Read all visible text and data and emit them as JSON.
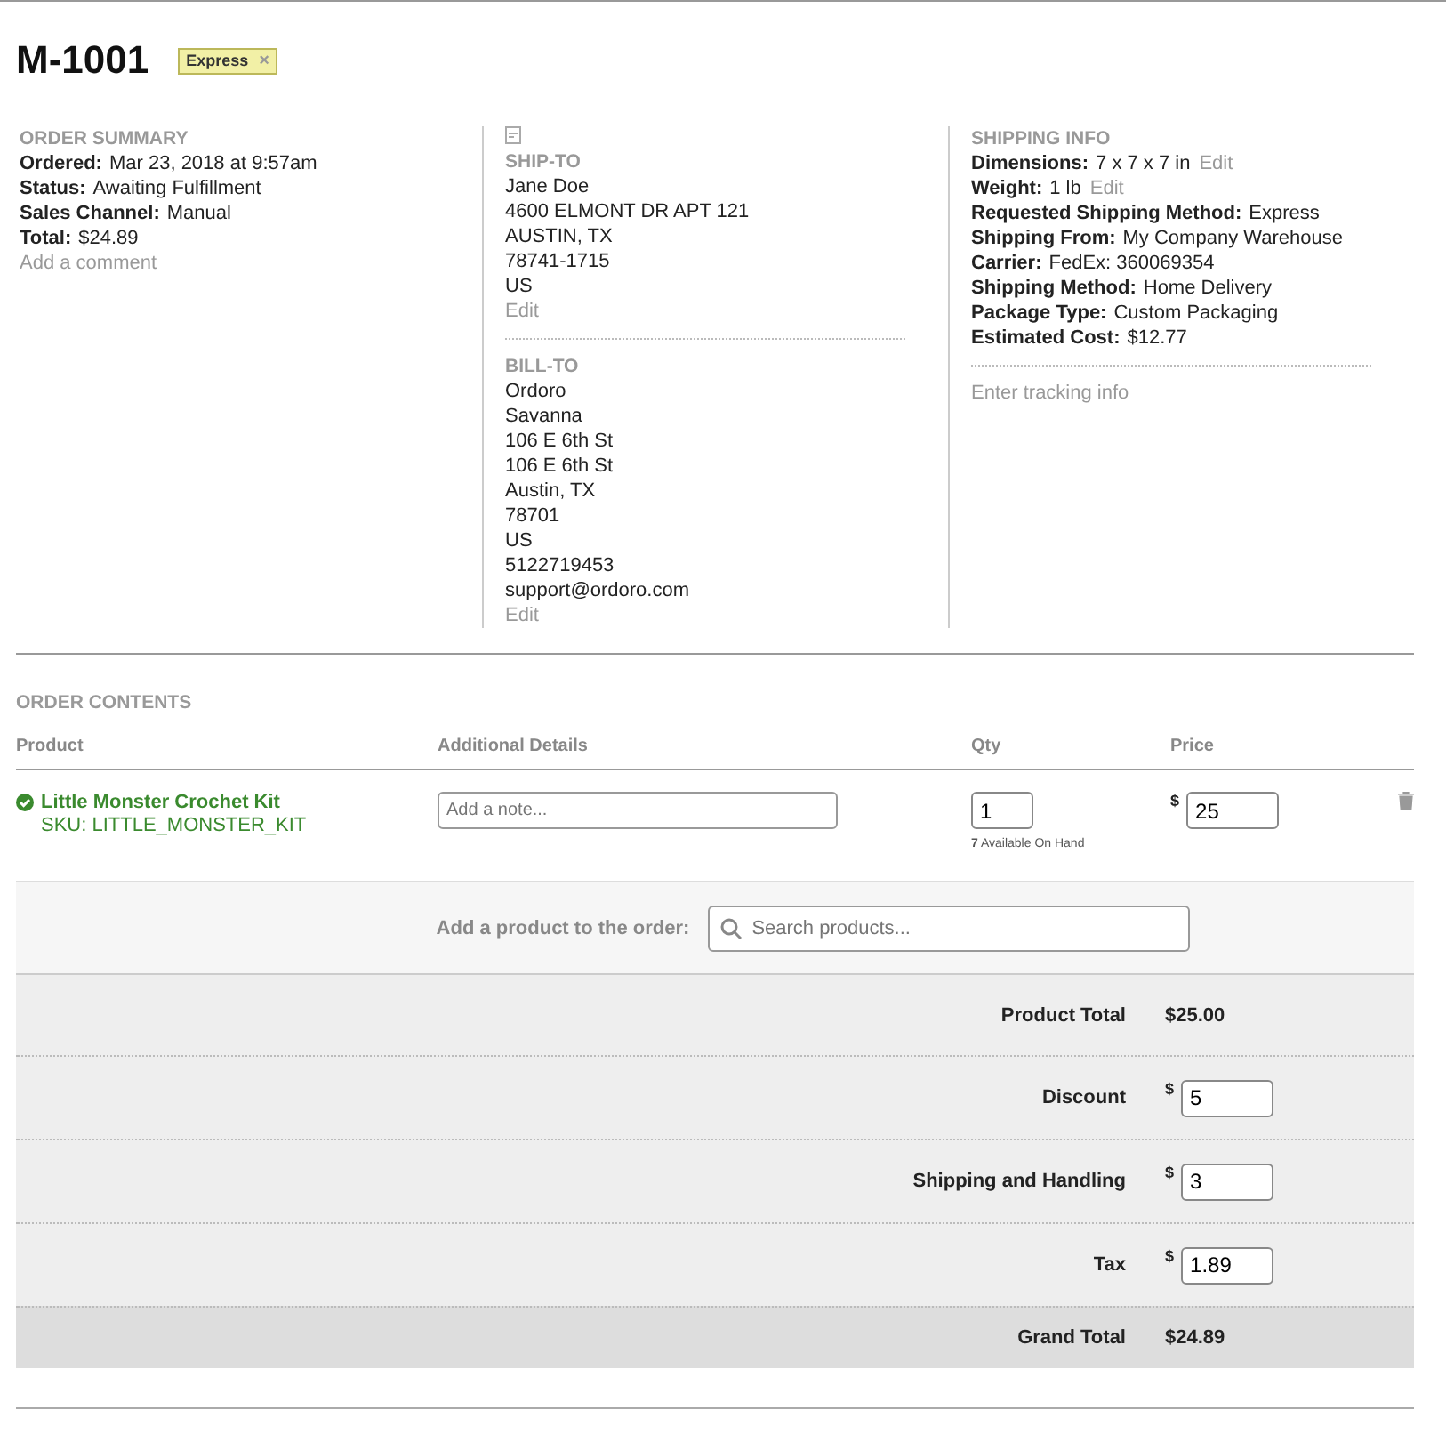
{
  "order": {
    "number": "M-1001",
    "tags": [
      {
        "label": "Express",
        "remove": "×",
        "color": "#f2f0a6"
      }
    ]
  },
  "summary": {
    "heading": "ORDER SUMMARY",
    "fields": [
      {
        "label": "Ordered:",
        "value": "Mar 23, 2018 at 9:57am"
      },
      {
        "label": "Status:",
        "value": "Awaiting Fulfillment"
      },
      {
        "label": "Sales Channel:",
        "value": "Manual"
      },
      {
        "label": "Total:",
        "value": "$24.89"
      }
    ],
    "link": "Add a comment"
  },
  "addresses": [
    {
      "heading": "SHIP-TO",
      "lines": [
        "Jane Doe",
        "4600 ELMONT DR APT 121",
        "AUSTIN, TX",
        "78741-1715",
        "US"
      ],
      "link": "Edit"
    },
    {
      "heading": "BILL-TO",
      "lines": [
        "Ordoro",
        "Savanna",
        "106 E 6th St",
        "106 E 6th St",
        "Austin, TX",
        "78701",
        "US",
        "5122719453",
        "support@ordoro.com"
      ],
      "link": "Edit"
    }
  ],
  "shipping": {
    "heading": "SHIPPING INFO",
    "fields": [
      {
        "label": "Dimensions:",
        "value": "7 x 7 x 7 in",
        "link": "Edit"
      },
      {
        "label": "Weight:",
        "value": "1 lb",
        "link": "Edit"
      },
      {
        "label": "Requested Shipping Method:",
        "value": "Express"
      },
      {
        "label": "Shipping From:",
        "value": "My Company Warehouse"
      },
      {
        "label": "Carrier:",
        "value": "FedEx: 360069354"
      },
      {
        "label": "Shipping Method:",
        "value": "Home Delivery"
      },
      {
        "label": "Package Type:",
        "value": "Custom Packaging"
      },
      {
        "label": "Estimated Cost:",
        "value": "$12.77"
      }
    ],
    "link": "Enter tracking info"
  },
  "contents": {
    "heading": "ORDER CONTENTS",
    "columns": [
      "Product",
      "Additional Details",
      "Qty",
      "Price"
    ],
    "lines": [
      {
        "name": "Little Monster Crochet Kit",
        "sku": "SKU: LITTLE_MONSTER_KIT",
        "note_placeholder": "Add a note...",
        "qty": "1",
        "available_count": "7",
        "available_label": "Available On Hand",
        "currency": "$",
        "price": "25"
      }
    ],
    "add_label": "Add a product to the order:",
    "search_placeholder": "Search products...",
    "totals": [
      {
        "kind": "static",
        "label": "Product Total",
        "value": "$25.00"
      },
      {
        "kind": "input",
        "label": "Discount",
        "currency": "$",
        "value": "5"
      },
      {
        "kind": "input",
        "label": "Shipping and Handling",
        "currency": "$",
        "value": "3"
      },
      {
        "kind": "input",
        "label": "Tax",
        "currency": "$",
        "value": "1.89"
      },
      {
        "kind": "grand",
        "label": "Grand Total",
        "value": "$24.89"
      }
    ]
  }
}
